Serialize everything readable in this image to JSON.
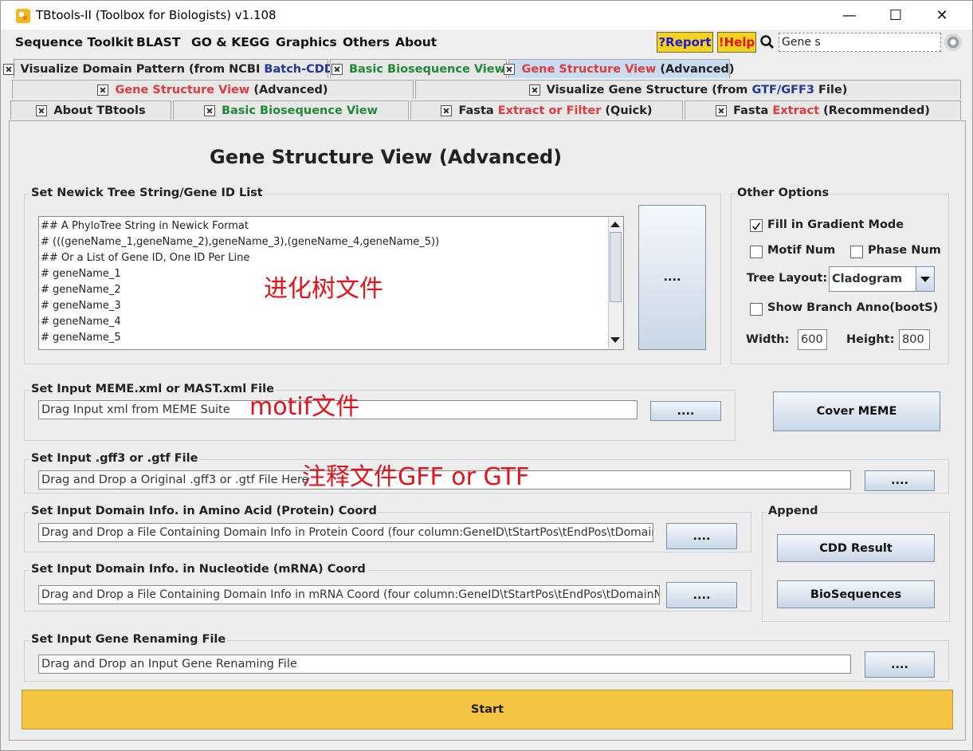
{
  "window": {
    "title": "TBtools-II (Toolbox for Biologists) v1.108",
    "minimize": "—",
    "maximize": "☐",
    "close": "✕"
  },
  "menu": [
    "Sequence Toolkit",
    "BLAST",
    "GO & KEGG",
    "Graphics",
    "Others",
    "About"
  ],
  "toolbar": {
    "report_label": "?Report",
    "help_label": "!Help",
    "search_value": "Gene s"
  },
  "tabs": {
    "row1": [
      {
        "parts": [
          {
            "t": "Visualize Domain Pattern (from NCBI ",
            "c": ""
          },
          {
            "t": "Batch-CDD",
            "c": "b"
          },
          {
            "t": ")",
            "c": ""
          }
        ]
      },
      {
        "parts": [
          {
            "t": "Basic Biosequence View",
            "c": "g"
          }
        ]
      },
      {
        "parts": [
          {
            "t": "Gene Structure View",
            "c": "r"
          },
          {
            "t": " (Advanced)",
            "c": ""
          }
        ]
      }
    ],
    "row2": [
      {
        "parts": [
          {
            "t": "Gene Structure View",
            "c": "r"
          },
          {
            "t": " (Advanced)",
            "c": ""
          }
        ]
      },
      {
        "parts": [
          {
            "t": "Visualize Gene Structure (from ",
            "c": ""
          },
          {
            "t": "GTF/GFF3",
            "c": "b"
          },
          {
            "t": " File)",
            "c": ""
          }
        ]
      }
    ],
    "row3": [
      {
        "parts": [
          {
            "t": "About TBtools",
            "c": ""
          }
        ]
      },
      {
        "parts": [
          {
            "t": "Basic Biosequence View",
            "c": "g"
          }
        ]
      },
      {
        "parts": [
          {
            "t": "Fasta ",
            "c": ""
          },
          {
            "t": "Extract or Filter",
            "c": "r"
          },
          {
            "t": " (Quick)",
            "c": ""
          }
        ]
      },
      {
        "parts": [
          {
            "t": "Fasta ",
            "c": ""
          },
          {
            "t": "Extract",
            "c": "r"
          },
          {
            "t": " (Recommended)",
            "c": ""
          }
        ]
      }
    ]
  },
  "main": {
    "title": "Gene Structure View (Advanced)",
    "newick": {
      "label": "Set Newick Tree String/Gene ID List",
      "lines": [
        "## A PhyloTree String in Newick Format",
        "# (((geneName_1,geneName_2),geneName_3),(geneName_4,geneName_5))",
        "## Or a List of Gene ID, One ID Per Line",
        "# geneName_1",
        "# geneName_2",
        "# geneName_3",
        "# geneName_4",
        "# geneName_5"
      ],
      "browse_label": "....",
      "annotation": "进化树文件"
    },
    "options": {
      "label": "Other Options",
      "fill_gradient": "Fill in Gradient Mode",
      "motif_num": "Motif Num",
      "phase_num": "Phase Num",
      "tree_layout_label": "Tree Layout:",
      "tree_layout_value": "Cladogram",
      "show_branch": "Show Branch Anno(bootS)",
      "width_label": "Width:",
      "width_value": "600",
      "height_label": "Height:",
      "height_value": "800"
    },
    "meme": {
      "label": "Set Input MEME.xml or MAST.xml File",
      "placeholder": "Drag Input xml from MEME Suite",
      "browse_label": "....",
      "annotation": "motif文件",
      "cover_label": "Cover MEME"
    },
    "gff": {
      "label": "Set Input .gff3 or .gtf File",
      "placeholder": "Drag and Drop a Original .gff3 or .gtf File Here",
      "browse_label": "....",
      "annotation": "注释文件GFF or GTF"
    },
    "domain_protein": {
      "label": "Set Input Domain Info. in Amino Acid (Protein) Coord",
      "placeholder": "Drag and Drop a File Containing Domain Info in Protein Coord (four column:GeneID\\tStartPos\\tEndPos\\tDomainName)",
      "browse_label": "...."
    },
    "domain_mrna": {
      "label": "Set Input Domain Info. in Nucleotide (mRNA) Coord",
      "placeholder": "Drag and Drop a File Containing Domain Info in mRNA Coord (four column:GeneID\\tStartPos\\tEndPos\\tDomainName)",
      "browse_label": "...."
    },
    "append": {
      "label": "Append",
      "cdd_label": "CDD Result",
      "bioseq_label": "BioSequences"
    },
    "rename": {
      "label": "Set Input Gene Renaming File",
      "placeholder": "Drag and Drop an Input Gene Renaming File",
      "browse_label": "...."
    },
    "start_label": "Start"
  }
}
